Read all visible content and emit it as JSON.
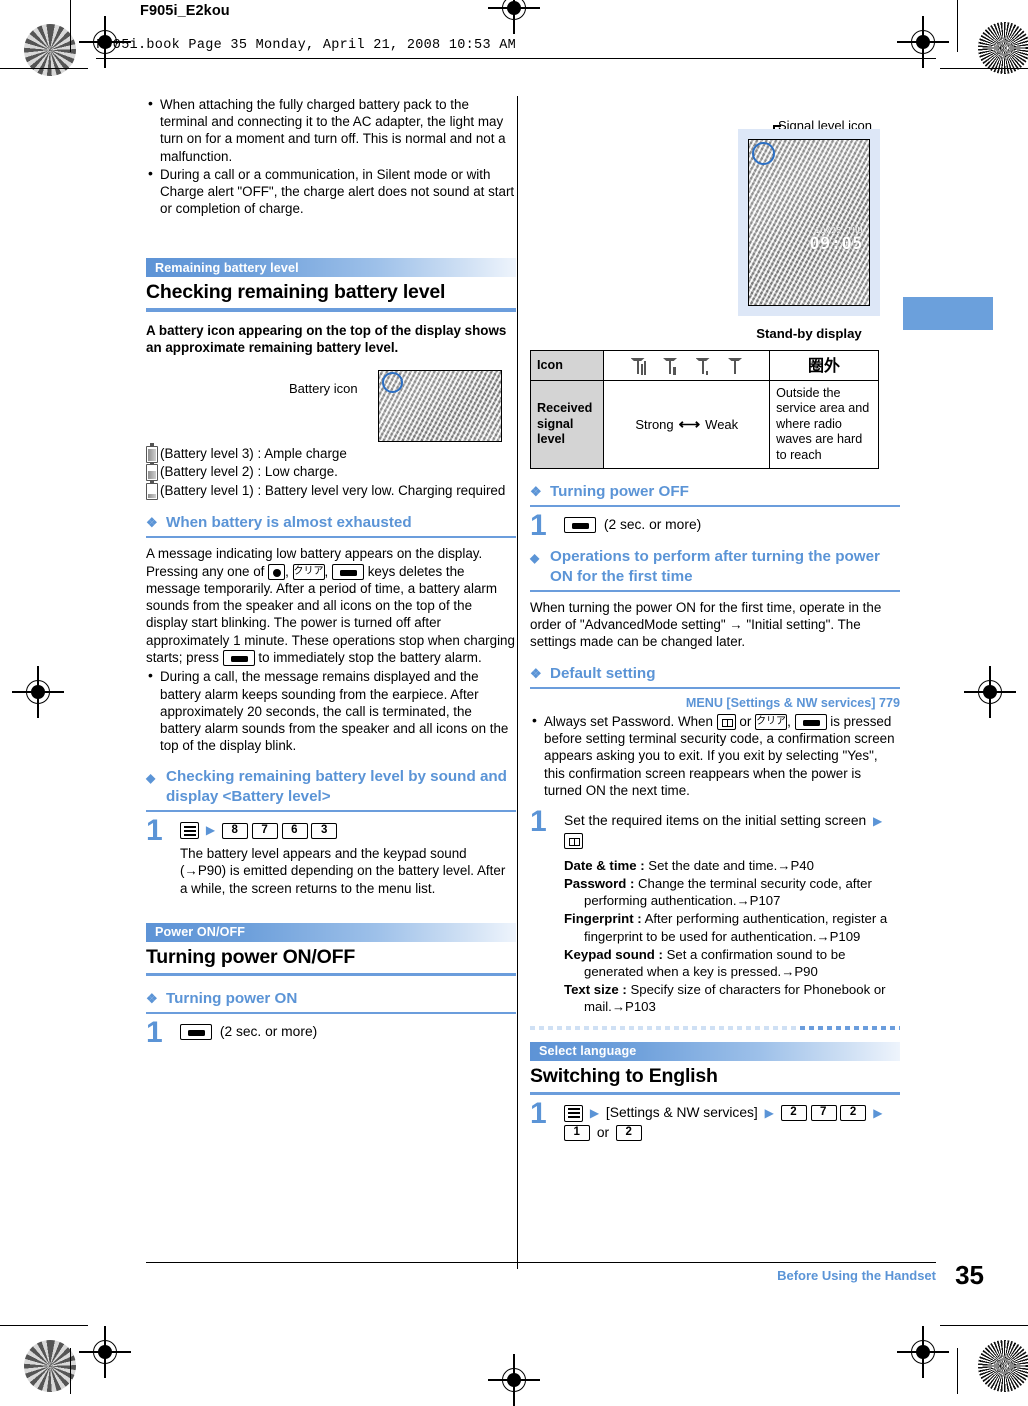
{
  "header": {
    "doc_id": "F905i_E2kou",
    "book_line": "F905i.book  Page 35  Monday, April 21, 2008  10:53 AM"
  },
  "footer": {
    "chapter": "Before Using the Handset",
    "page_number": "35"
  },
  "colors": {
    "accent_blue": "#5b94d6",
    "rule_blue": "#6b9ddc",
    "banner_blue": "#5d93d6",
    "tab_blue": "#6ba0dc"
  },
  "left_column": {
    "intro_bullets": [
      "When attaching the fully charged battery pack to the terminal and connecting it to the AC adapter, the light may turn on for a moment and turn off. This is normal and not a malfunction.",
      "During a call or a communication, in Silent mode or with Charge alert \"OFF\", the charge alert does not sound at start or completion of charge."
    ],
    "section_battery": {
      "banner": "Remaining battery level",
      "title": "Checking remaining battery level",
      "lead": "A battery icon appearing on the top of the display shows an approximate remaining battery level.",
      "figure_label": "Battery icon",
      "levels": [
        "(Battery level 3) : Ample charge",
        "(Battery level 2) : Low charge.",
        "(Battery level 1) : Battery level very low. Charging required"
      ]
    },
    "exhausted": {
      "heading": "When battery is almost exhausted",
      "para_1": "A message indicating low battery appears on the display. Pressing any one of",
      "para_2": "keys deletes the message temporarily. After a period of time, a battery alarm sounds from the speaker and all icons on the top of the display start blinking. The power is turned off after approximately 1 minute. These operations stop when charging starts; press",
      "para_3": "to immediately stop the battery alarm.",
      "bullet": "During a call, the message remains displayed and the battery alarm keeps sounding from the earpiece. After approximately 20 seconds, the call is terminated, the battery alarm sounds from the speaker and all icons on the top of the display blink."
    },
    "check_by_sound": {
      "heading": "Checking remaining battery level by sound and display <Battery level>",
      "step_number": "1",
      "keys": [
        "8",
        "7",
        "6",
        "3"
      ],
      "desc": "The battery level appears and the keypad sound (→P90) is emitted depending on the battery level. After a while, the screen returns to the menu list."
    },
    "section_power": {
      "banner": "Power ON/OFF",
      "title": "Turning power ON/OFF",
      "turning_on": {
        "heading": "Turning power ON",
        "step_number": "1",
        "step_text": "(2 sec. or more)"
      }
    }
  },
  "right_column": {
    "standby_figure": {
      "callout": "Signal level icon",
      "caption": "Stand-by display",
      "screen_time": "09:05",
      "screen_date": "10/25  THU"
    },
    "signal_table": {
      "row1_header": "Icon",
      "row2_header": "Received signal level",
      "strong_label": "Strong",
      "weak_label": "Weak",
      "out_of_area_icon": "圈外",
      "out_of_area_text": "Outside the service area and where radio waves are hard to reach"
    },
    "turning_off": {
      "heading": "Turning power OFF",
      "step_number": "1",
      "step_text": "(2 sec. or more)"
    },
    "first_time": {
      "heading": "Operations to perform after turning the power ON for the first time",
      "body": "When turning the power ON for the first time, operate in the order of \"AdvancedMode setting\" → \"Initial setting\". The settings made can be changed later."
    },
    "default_setting": {
      "heading": "Default setting",
      "menu_ref": "MENU [Settings & NW services] 779",
      "bullet_1": "Always set Password. When",
      "bullet_2": "or",
      "bullet_3": "is pressed before setting terminal security code, a confirmation screen appears asking you to exit. If you exit by selecting \"Yes\", this confirmation screen reappears when the power is turned ON the next time.",
      "step_number": "1",
      "step_text": "Set the required items on the initial setting screen",
      "items": [
        {
          "term": "Date & time :",
          "desc": "Set the date and time.→P40"
        },
        {
          "term": "Password :",
          "desc": "Change the terminal security code, after performing authentication.→P107"
        },
        {
          "term": "Fingerprint :",
          "desc": "After performing authentication, register a fingerprint to be used for authentication.→P109"
        },
        {
          "term": "Keypad sound :",
          "desc": "Set a confirmation sound to be generated when a key is pressed.→P90"
        },
        {
          "term": "Text size :",
          "desc": "Specify size of characters for Phonebook or mail.→P103"
        }
      ]
    },
    "select_language": {
      "banner": "Select language",
      "title": "Switching to English",
      "step_number": "1",
      "menu_label": "[Settings & NW services]",
      "keys_a": [
        "2",
        "7",
        "2"
      ],
      "keys_b": [
        "1",
        "2"
      ],
      "or_label": "or"
    }
  }
}
